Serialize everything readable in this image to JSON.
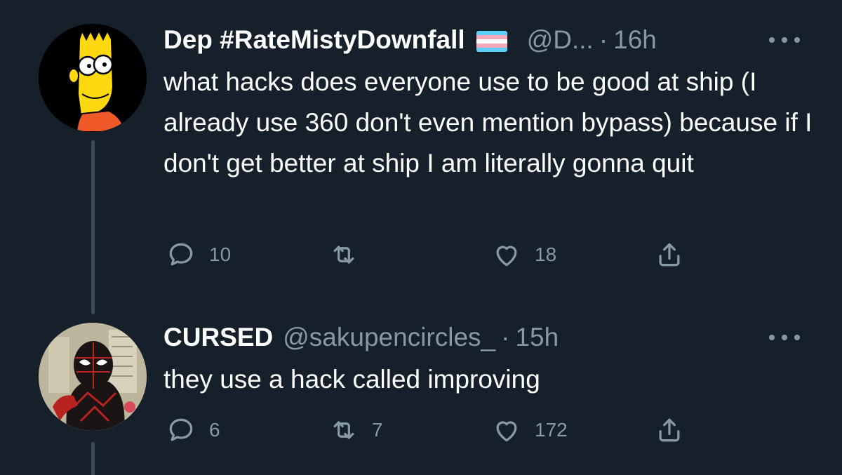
{
  "tweets": [
    {
      "display_name": "Dep #RateMistyDownfall",
      "flag_icon": "transgender-flag-icon",
      "handle": "@D...",
      "separator": "·",
      "time": "16h",
      "text": "what hacks does everyone use to be good at ship (I already use 360 don't even mention bypass) because if I don't get better at ship I am literally gonna quit",
      "replies": "10",
      "retweets": "",
      "likes": "18",
      "avatar_icon": "bart-simpson-avatar"
    },
    {
      "display_name": "CURSED",
      "handle": "@sakupencircles_",
      "separator": "·",
      "time": "15h",
      "text": "they use a hack called improving",
      "replies": "6",
      "retweets": "7",
      "likes": "172",
      "avatar_icon": "spiderman-avatar"
    }
  ],
  "colors": {
    "background": "#15202b",
    "text": "#ffffff",
    "secondary": "#8899a6",
    "thread_line": "#3d4c5c",
    "flag_blue": "#5bcefa",
    "flag_pink": "#f5a9b8",
    "flag_white": "#ffffff"
  }
}
